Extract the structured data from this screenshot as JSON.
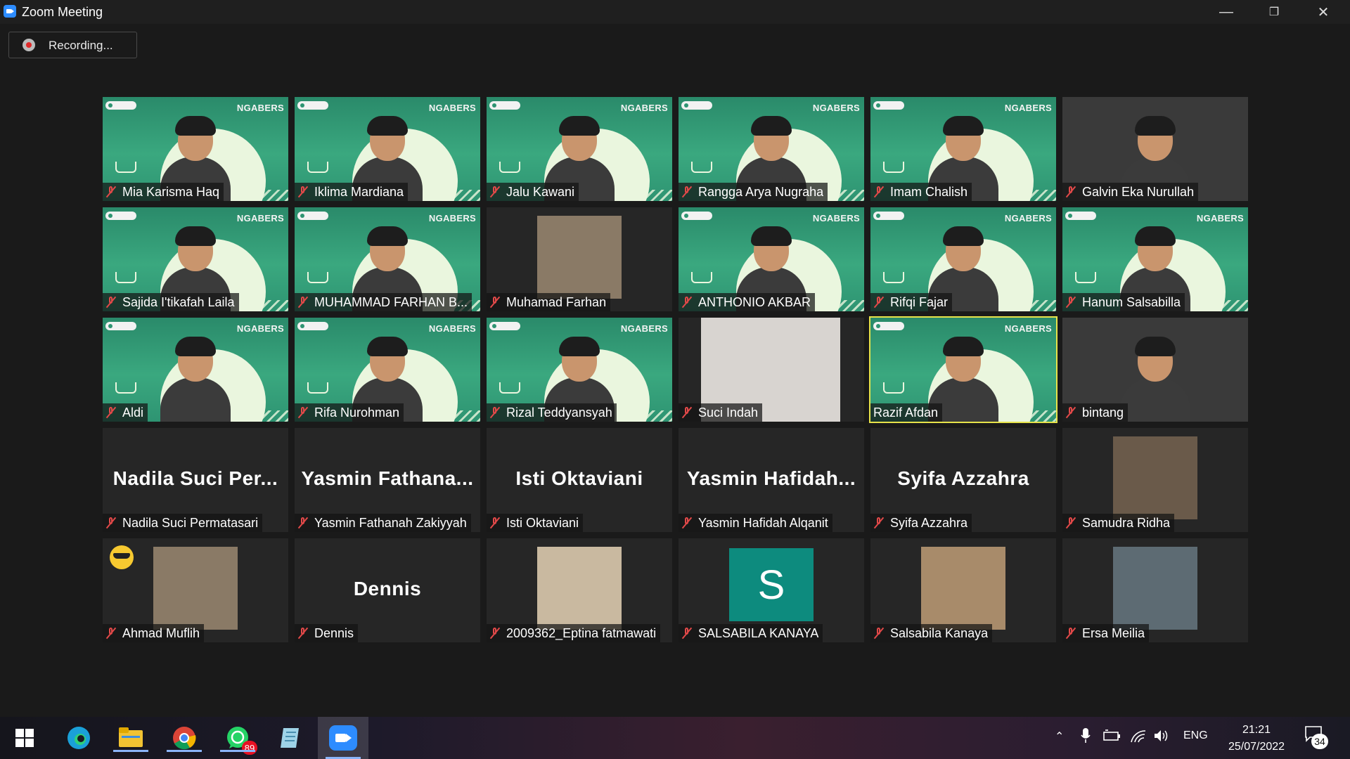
{
  "window": {
    "title": "Zoom Meeting"
  },
  "recording": {
    "label": "Recording..."
  },
  "banner_brand": "NGABERS",
  "participants": [
    {
      "name": "Mia Karisma Haq",
      "type": "banner"
    },
    {
      "name": "Iklima Mardiana",
      "type": "banner"
    },
    {
      "name": "Jalu Kawani",
      "type": "banner"
    },
    {
      "name": "Rangga Arya Nugraha",
      "type": "banner"
    },
    {
      "name": "Imam Chalish",
      "type": "banner"
    },
    {
      "name": "Galvin Eka Nurullah",
      "type": "camera"
    },
    {
      "name": "Sajida I'tikafah Laila",
      "type": "banner"
    },
    {
      "name": "MUHAMMAD FARHAN B...",
      "type": "banner"
    },
    {
      "name": "Muhamad Farhan",
      "type": "photo"
    },
    {
      "name": "ANTHONIO AKBAR",
      "type": "banner"
    },
    {
      "name": "Rifqi Fajar",
      "type": "banner"
    },
    {
      "name": "Hanum Salsabilla",
      "type": "banner"
    },
    {
      "name": "Aldi",
      "type": "banner"
    },
    {
      "name": "Rifa Nurohman",
      "type": "banner"
    },
    {
      "name": "Rizal Teddyansyah",
      "type": "banner"
    },
    {
      "name": "Suci Indah",
      "type": "photo"
    },
    {
      "name": "Razif Afdan",
      "type": "banner",
      "speaking": true
    },
    {
      "name": "bintang",
      "type": "camera"
    },
    {
      "name": "Nadila Suci Permatasari",
      "type": "text",
      "display": "Nadila Suci Per..."
    },
    {
      "name": "Yasmin Fathanah Zakiyyah",
      "type": "text",
      "display": "Yasmin Fathana..."
    },
    {
      "name": "Isti Oktaviani",
      "type": "text",
      "display": "Isti Oktaviani"
    },
    {
      "name": "Yasmin Hafidah Alqanit",
      "type": "text",
      "display": "Yasmin Hafidah..."
    },
    {
      "name": "Syifa Azzahra",
      "type": "text",
      "display": "Syifa Azzahra"
    },
    {
      "name": "Samudra Ridha",
      "type": "photo"
    },
    {
      "name": "Ahmad Muflih",
      "type": "photo",
      "emoji": true
    },
    {
      "name": "Dennis",
      "type": "text",
      "display": "Dennis"
    },
    {
      "name": "2009362_Eptina fatmawati",
      "type": "photo"
    },
    {
      "name": "SALSABILA KANAYA",
      "type": "avatar",
      "initial": "S"
    },
    {
      "name": "Salsabila Kanaya",
      "type": "photo"
    },
    {
      "name": "Ersa Meilia",
      "type": "photo"
    }
  ],
  "taskbar": {
    "whatsapp_badge": "89",
    "language": "ENG",
    "time": "21:21",
    "date": "25/07/2022",
    "notifications": "34"
  },
  "colors": {
    "mic_muted": "#e34949",
    "speaking_border": "#e7e34a",
    "banner": "#3aa87f"
  }
}
